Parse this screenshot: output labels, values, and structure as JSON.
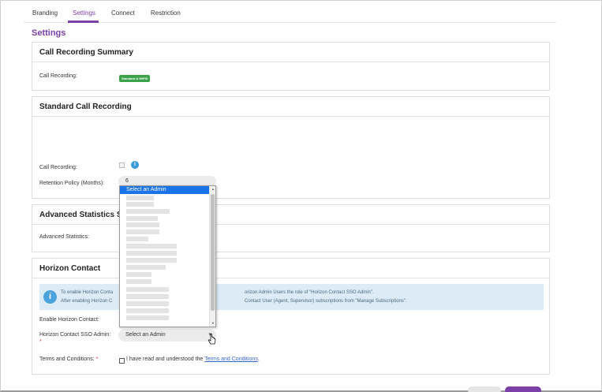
{
  "tabs": [
    "Branding",
    "Settings",
    "Connect",
    "Restriction"
  ],
  "active_tab": "Settings",
  "page_title": "Settings",
  "call_recording_summary": {
    "title": "Call Recording Summary",
    "label": "Call Recording:",
    "badge": "Standard & MiFID",
    "badge_color": "#3aa34a"
  },
  "standard_call_recording": {
    "title": "Standard Call Recording",
    "call_recording_label": "Call Recording:",
    "retention_label": "Retention Policy (Months):",
    "retention_value": "6",
    "info_icon": "i"
  },
  "advanced_statistics": {
    "title": "Advanced Statistics S",
    "label": "Advanced Statistics:"
  },
  "horizon_contact": {
    "title": "Horizon Contact",
    "banner_line1_left": "To enable Horizon Conta",
    "banner_line1_right": "orizon Admin Users the role of \"Horizon Contact SSO Admin\".",
    "banner_line2_left": "After enabling Horizon C",
    "banner_line2_right": "Contact User (Agent, Supervisor) subscriptions from \"Manage Subscriptions\".",
    "enable_label": "Enable Horizon Contact:",
    "sso_admin_label": "Horizon Contact SSO Admin:",
    "required_mark": "*",
    "sso_admin_value": "Select an Admin",
    "terms_label": "Terms and Conditions:",
    "terms_required": "*",
    "terms_text": "I have read and understood the ",
    "terms_link": "Terms and Conditions",
    "terms_period": "."
  },
  "dropdown": {
    "selected_option": "Select an Admin",
    "accent": "#1a73e8"
  },
  "colors": {
    "brand": "#7b3fa8",
    "info": "#3a9bd8",
    "banner_bg": "#dcebf5"
  }
}
